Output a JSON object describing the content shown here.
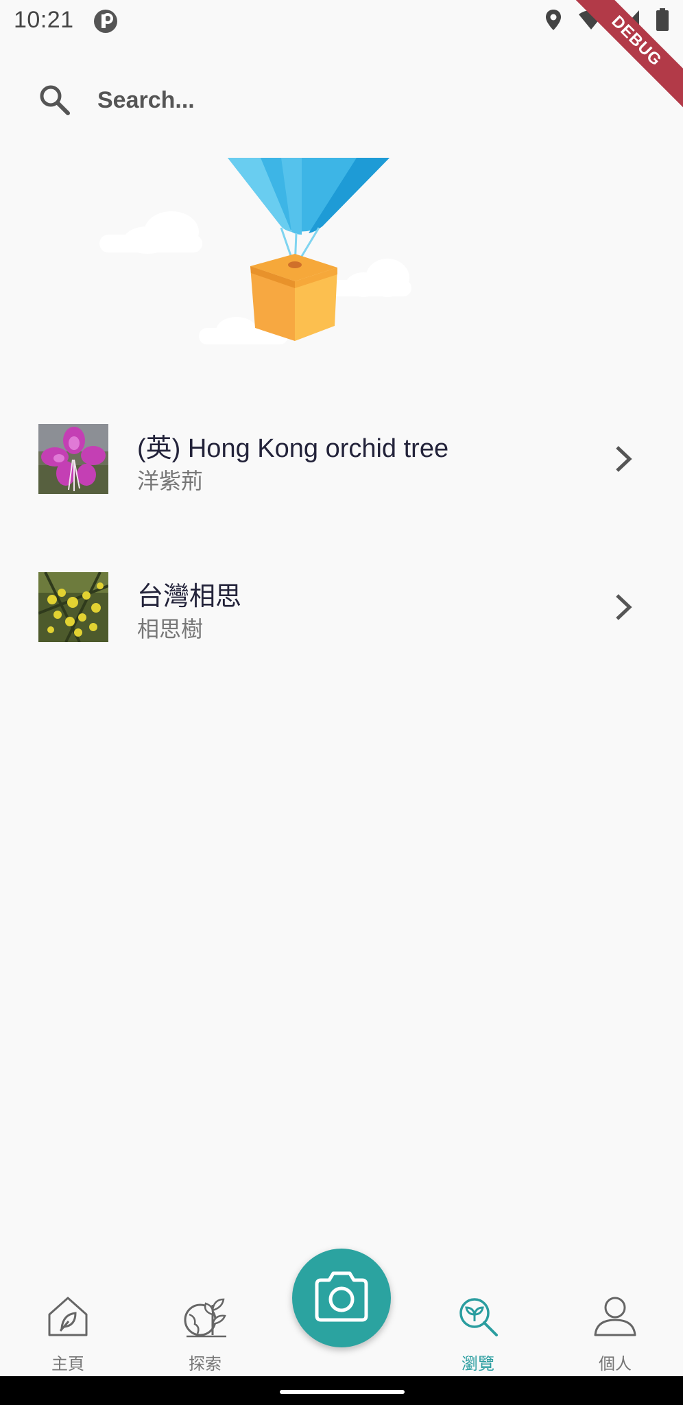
{
  "status_bar": {
    "time": "10:21",
    "debug_label": "DEBUG"
  },
  "search": {
    "placeholder": "Search..."
  },
  "plants": [
    {
      "title": "(英) Hong Kong orchid tree",
      "subtitle": "洋紫荊"
    },
    {
      "title": "台灣相思",
      "subtitle": "相思樹"
    }
  ],
  "bottom_nav": [
    {
      "label": "主頁",
      "icon": "home-leaf-icon"
    },
    {
      "label": "探索",
      "icon": "globe-plant-icon"
    },
    {
      "label": "瀏覽",
      "icon": "plant-search-icon",
      "active": true
    },
    {
      "label": "個人",
      "icon": "person-icon"
    }
  ],
  "camera": {
    "icon": "camera-icon"
  },
  "colors": {
    "accent": "#2ba3a0",
    "background": "#f9f9f9",
    "debug_ribbon": "#b23a48"
  }
}
